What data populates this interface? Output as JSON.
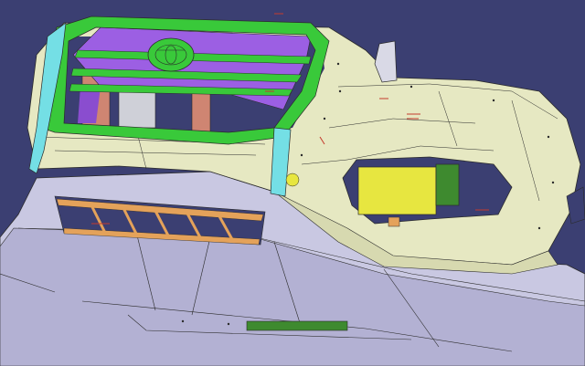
{
  "viewport": {
    "background": "#3b3f72",
    "subject": "front-bumper-assembly"
  },
  "colors": {
    "bumper_skin": "#e6e8c2",
    "lower_fascia": "#c9c8e2",
    "grille_frame": "#39c93a",
    "grille_inner": "#9c5fe3",
    "side_bracket": "#74dfe5",
    "support_post": "#cf8572",
    "lower_vent": "#e4a25a",
    "fog_lamp": "#e7e640",
    "fog_lamp_mount": "#3e8a2f",
    "edge_line": "#2b2b2b",
    "annotation_red": "#c43b2e"
  },
  "parts": [
    "bumper-skin",
    "lower-fascia",
    "grille-frame",
    "grille-inner",
    "grille-emblem",
    "side-bracket-left",
    "support-posts",
    "lower-vent-grille",
    "fog-lamp",
    "fog-lamp-mount",
    "mounting-bracket-right",
    "bottom-skid-plate",
    "annotation-marks"
  ]
}
